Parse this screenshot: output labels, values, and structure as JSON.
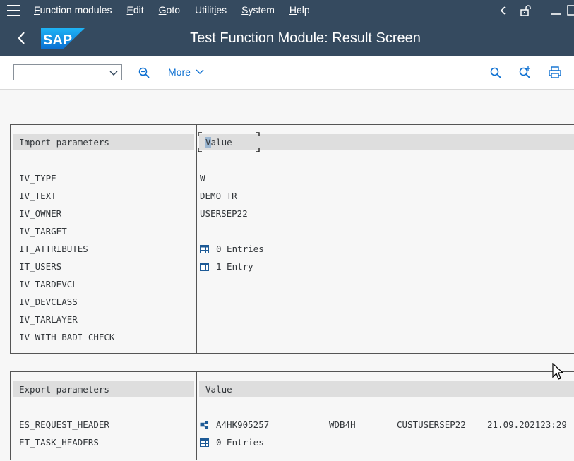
{
  "menubar": {
    "items": [
      {
        "label": "Function modules",
        "u": "F",
        "rest": "unction modules"
      },
      {
        "label": "Edit",
        "u": "E",
        "rest": "dit"
      },
      {
        "label": "Goto",
        "u": "G",
        "rest": "oto"
      },
      {
        "label": "Utilities",
        "pre": "Utilit",
        "u": "i",
        "rest": "es"
      },
      {
        "label": "System",
        "u": "S",
        "rest": "ystem"
      },
      {
        "label": "Help",
        "u": "H",
        "rest": "elp"
      }
    ]
  },
  "titlebar": {
    "logo_text": "SAP",
    "title": "Test Function Module: Result Screen"
  },
  "toolbar": {
    "more_label": "More",
    "command_value": ""
  },
  "import": {
    "header_name": "Import parameters",
    "header_value": "Value",
    "rows": [
      {
        "name": "IV_TYPE",
        "value": "W"
      },
      {
        "name": "IV_TEXT",
        "value": "DEMO TR"
      },
      {
        "name": "IV_OWNER",
        "value": "USERSEP22"
      },
      {
        "name": "IV_TARGET",
        "value": ""
      },
      {
        "name": "IT_ATTRIBUTES",
        "value": "0 Entries"
      },
      {
        "name": "IT_USERS",
        "value": "1 Entry"
      },
      {
        "name": "IV_TARDEVCL",
        "value": ""
      },
      {
        "name": "IV_DEVCLASS",
        "value": ""
      },
      {
        "name": "IV_TARLAYER",
        "value": ""
      },
      {
        "name": "IV_WITH_BADI_CHECK",
        "value": ""
      }
    ]
  },
  "export": {
    "header_name": "Export parameters",
    "header_value": "Value",
    "rows": [
      {
        "name": "ES_REQUEST_HEADER",
        "value_cols": [
          "A4HK905257",
          "WDB4H",
          "CUSTUSERSEP22",
          "21.09.202123:29"
        ]
      },
      {
        "name": "ET_TASK_HEADERS",
        "value": "0 Entries"
      }
    ]
  },
  "colors": {
    "shell": "#354a5f",
    "link": "#0a6ed1",
    "header_cell": "#dedede"
  }
}
